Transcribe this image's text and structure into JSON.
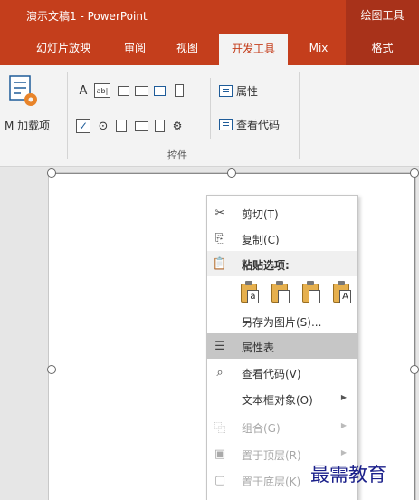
{
  "titlebar": {
    "title": "演示文稿1 - PowerPoint",
    "context_tab": "绘图工具"
  },
  "tabs": [
    {
      "label": "幻灯片放映"
    },
    {
      "label": "审阅"
    },
    {
      "label": "视图"
    },
    {
      "label": "开发工具",
      "active": true
    },
    {
      "label": "Mix"
    },
    {
      "label": "格式",
      "contextual": true
    }
  ],
  "ribbon": {
    "addins_label": "M 加载项",
    "properties_label": "属性",
    "view_code_label": "查看代码",
    "controls_group_label": "控件",
    "control_glyphs": {
      "label": "A",
      "textbox": "ab|",
      "checkbox": "✓",
      "radio": "⊙"
    }
  },
  "context_menu": {
    "items": [
      {
        "icon": "scissors-icon",
        "label": "剪切(T)",
        "enabled": true
      },
      {
        "icon": "copy-icon",
        "label": "复制(C)",
        "enabled": true
      },
      {
        "icon": "clipboard-icon",
        "label": "粘贴选项:",
        "section": true
      },
      {
        "label": "另存为图片(S)...",
        "enabled": true
      },
      {
        "icon": "properties-icon",
        "label": "属性表",
        "enabled": true,
        "highlighted": true
      },
      {
        "icon": "view-code-icon",
        "label": "查看代码(V)",
        "enabled": true
      },
      {
        "label": "文本框对象(O)",
        "enabled": true,
        "submenu": true
      },
      {
        "icon": "group-icon",
        "label": "组合(G)",
        "enabled": false,
        "submenu": true
      },
      {
        "icon": "bring-front-icon",
        "label": "置于顶层(R)",
        "enabled": false,
        "submenu": true
      },
      {
        "icon": "send-back-icon",
        "label": "置于底层(K)",
        "enabled": false
      }
    ],
    "paste_options": [
      "a",
      "",
      "",
      "A"
    ]
  },
  "watermark": "最需教育",
  "colors": {
    "accent": "#c43e1c",
    "context_tab": "#a8321a",
    "highlight": "#c6c6c6"
  }
}
